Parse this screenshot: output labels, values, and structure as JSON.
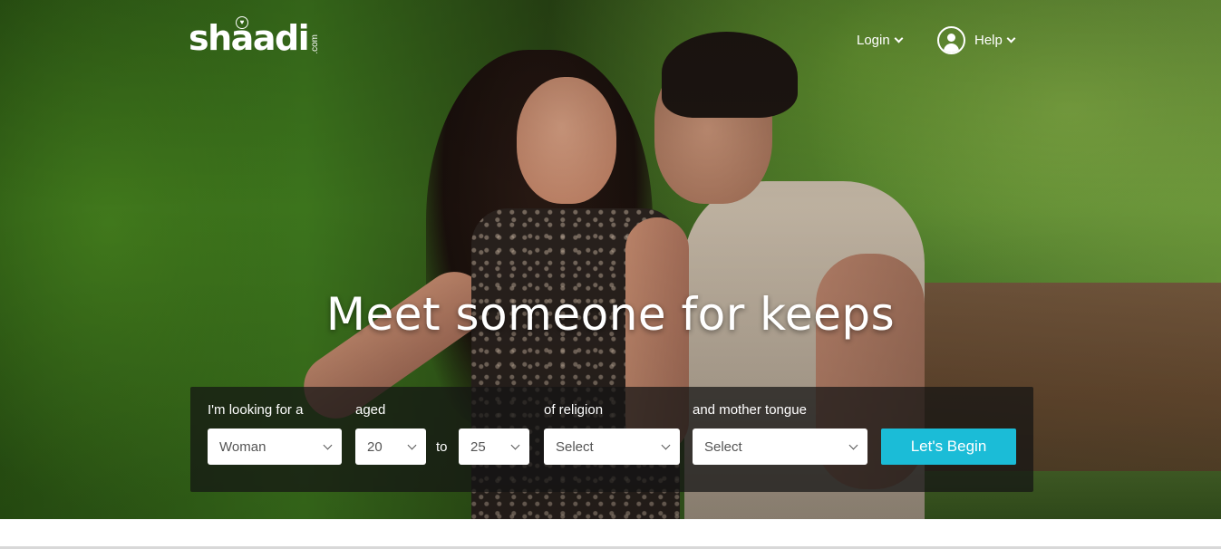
{
  "header": {
    "logo_text": "shaadi",
    "logo_suffix": ".com",
    "login_label": "Login",
    "help_label": "Help"
  },
  "hero": {
    "headline": "Meet someone for keeps"
  },
  "search": {
    "looking_for_label": "I'm looking for a",
    "looking_for_value": "Woman",
    "aged_label": "aged",
    "age_from_value": "20",
    "to_label": "to",
    "age_to_value": "25",
    "religion_label": "of religion",
    "religion_value": "Select",
    "mother_tongue_label": "and mother tongue",
    "mother_tongue_value": "Select",
    "submit_label": "Let's Begin"
  },
  "colors": {
    "accent": "#1bbcd7",
    "panel_bg": "rgba(20,20,20,0.72)",
    "text_on_dark": "#ffffff"
  },
  "icons": [
    "heart-icon",
    "chevron-down-icon",
    "user-avatar-icon"
  ]
}
